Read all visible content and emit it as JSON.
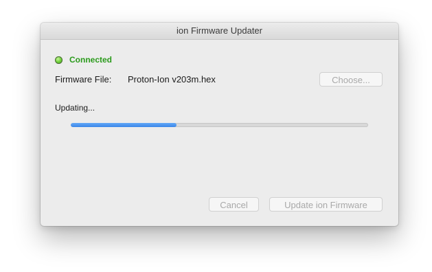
{
  "window": {
    "title": "ion Firmware Updater"
  },
  "status": {
    "text": "Connected",
    "color": "#2a9a1b"
  },
  "firmware": {
    "label": "Firmware File:",
    "value": "Proton-Ion v203m.hex",
    "choose_label": "Choose..."
  },
  "progress": {
    "label": "Updating...",
    "fraction": 0.355,
    "accent": "#3b86e8"
  },
  "actions": {
    "cancel_label": "Cancel",
    "update_label": "Update ion Firmware"
  }
}
